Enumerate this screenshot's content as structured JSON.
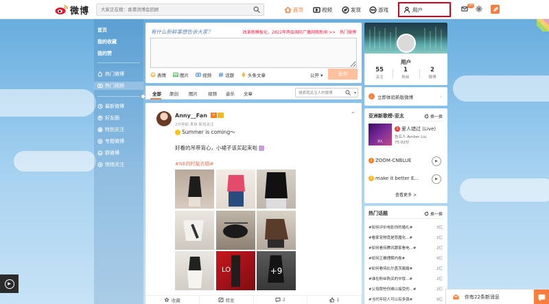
{
  "topbar": {
    "logo_text": "微博",
    "search_placeholder": "大家正在搜：香港消博会回顾",
    "nav_home": "首页",
    "nav_video": "视频",
    "nav_discover": "发现",
    "nav_game": "游戏",
    "nav_user": "用户",
    "msg_badge": "35"
  },
  "sidebar": {
    "items": [
      {
        "label": "首页"
      },
      {
        "label": "我的收藏"
      },
      {
        "label": "我的赞"
      },
      {
        "label": "热门微博"
      },
      {
        "label": "热门视频"
      },
      {
        "label": "最新微博"
      },
      {
        "label": "好友圈"
      },
      {
        "label": "特别关注"
      },
      {
        "label": "专题微博"
      },
      {
        "label": "群微博"
      },
      {
        "label": "悄悄关注"
      }
    ]
  },
  "post_box": {
    "hint": "有什么新鲜事想告诉大家？",
    "topic": "改革新模板化，2022年两会国际广播网络新闻 >>　热门微博",
    "tools": [
      "表情",
      "图片",
      "视频",
      "话题",
      "头条文章"
    ],
    "visibility": "公开",
    "submit": "发布"
  },
  "tabs": {
    "items": [
      "全部",
      "原创",
      "图片",
      "视频",
      "音乐",
      "文章"
    ],
    "search_placeholder": "搜索我关注人的微博"
  },
  "feed": {
    "username": "Anny__Fan",
    "vip": "V",
    "meta": "2分钟前 来自 新加关注",
    "text1": "Summer is coming～",
    "text2": "好看的吊带背心，小裙子该买起来啦",
    "hashtag": "#NE的时髦衣橱#",
    "more_count": "+9",
    "actions": [
      {
        "label": "收藏"
      },
      {
        "label": "转发"
      },
      {
        "label": "2"
      },
      {
        "label": "1"
      }
    ]
  },
  "profile": {
    "name": "用户",
    "stats": [
      {
        "num": "55",
        "label": "关注"
      },
      {
        "num": "1",
        "label": "粉丝"
      },
      {
        "num": "2",
        "label": "微博"
      }
    ]
  },
  "try_card": {
    "label": "立即体验新版微博"
  },
  "music": {
    "title": "亚洲新歌榜-亚太",
    "refresh": "换一换",
    "songs": [
      {
        "rank": "1",
        "title": "爱人错过 (Live)",
        "artist": "告五人 Amber Liu",
        "duration": "75.02分"
      },
      {
        "rank": "2",
        "title": "ZOOM-CNBLUE"
      },
      {
        "rank": "3",
        "title": "make it better E…"
      }
    ],
    "more": "查看更多 >",
    "cover_text": "双九"
  },
  "topics": {
    "title": "热门话题",
    "refresh": "换一换",
    "items": [
      {
        "label": "#如何评价电影你的婚礼#",
        "count": "3亿"
      },
      {
        "label": "#看家宠物竟是恶魔化...#",
        "count": "2亿"
      },
      {
        "label": "#如何看待腾讯跟家看电...#",
        "count": "2亿"
      },
      {
        "label": "#如何正确理解内卷#",
        "count": "9亿"
      },
      {
        "label": "#如何看待比尔盖茨离婚#",
        "count": "2亿"
      },
      {
        "label": "#谁在粉丝购买的中饭...#",
        "count": "2亿"
      },
      {
        "label": "#父母那些你难以接受的...#",
        "count": "2亿"
      },
      {
        "label": "#当代年轻人可以有多强#",
        "count": "9亿"
      }
    ]
  },
  "message_bar": {
    "text": "你有22条新消息"
  },
  "colors": {
    "accent": "#fa7d3c",
    "highlight_border": "#d0021b",
    "link": "#eb7350"
  }
}
